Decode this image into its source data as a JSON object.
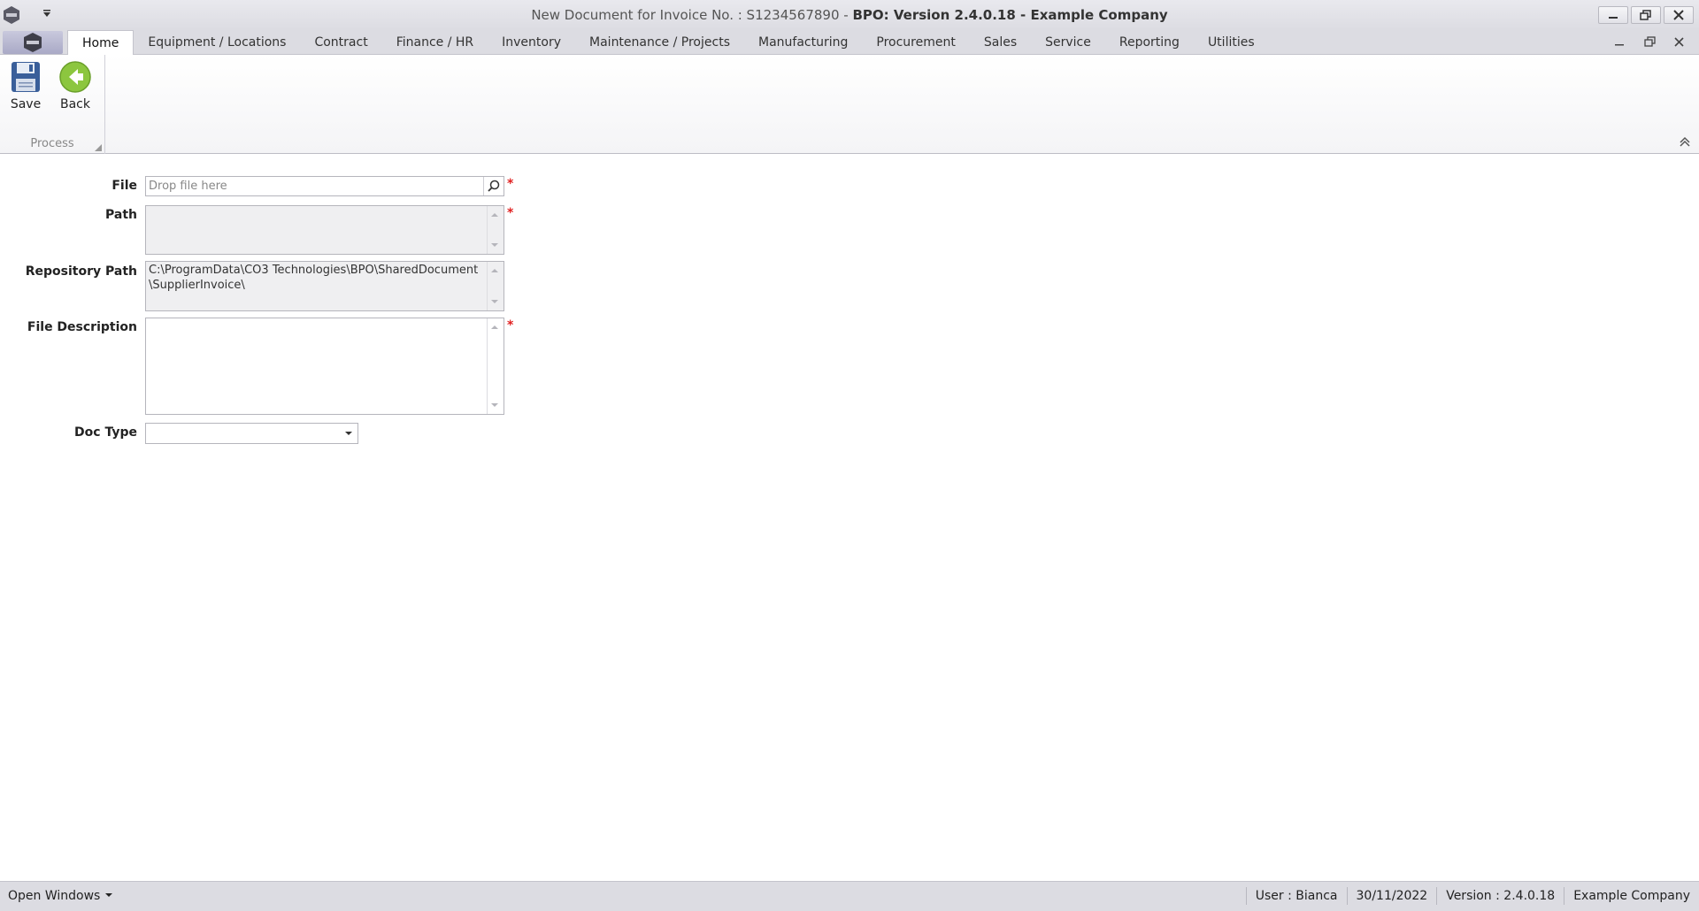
{
  "window": {
    "title_prefix": "New Document for Invoice No. : S1234567890 - ",
    "title_main": "BPO: Version 2.4.0.18 - Example Company"
  },
  "tabs": [
    {
      "label": "Home",
      "active": true
    },
    {
      "label": "Equipment / Locations"
    },
    {
      "label": "Contract"
    },
    {
      "label": "Finance / HR"
    },
    {
      "label": "Inventory"
    },
    {
      "label": "Maintenance / Projects"
    },
    {
      "label": "Manufacturing"
    },
    {
      "label": "Procurement"
    },
    {
      "label": "Sales"
    },
    {
      "label": "Service"
    },
    {
      "label": "Reporting"
    },
    {
      "label": "Utilities"
    }
  ],
  "ribbon": {
    "save_label": "Save",
    "back_label": "Back",
    "group_label": "Process"
  },
  "form": {
    "file_label": "File",
    "file_placeholder": "Drop file here",
    "path_label": "Path",
    "path_value": "",
    "repo_label": "Repository Path",
    "repo_line1": "C:\\ProgramData\\CO3 Technologies\\BPO\\SharedDocument",
    "repo_line2": "\\SupplierInvoice\\",
    "desc_label": "File Description",
    "desc_value": "",
    "doctype_label": "Doc Type",
    "doctype_value": "",
    "required_marker": "*"
  },
  "status": {
    "open_windows": "Open Windows",
    "user": "User : Bianca",
    "date": "30/11/2022",
    "version": "Version : 2.4.0.18",
    "company": "Example Company"
  },
  "colors": {
    "accent_required": "#e02020",
    "back_green": "#8cc63f",
    "save_blue": "#3a5f9a"
  }
}
